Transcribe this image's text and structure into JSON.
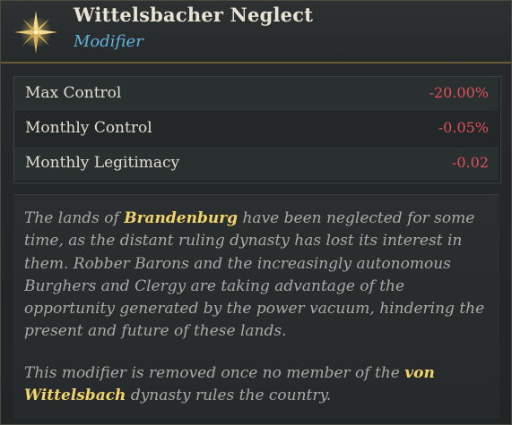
{
  "header": {
    "title": "Wittelsbacher Neglect",
    "subtitle": "Modifier",
    "icon": "compass-star-icon"
  },
  "modifiers": [
    {
      "label": "Max Control",
      "value": "-20.00%"
    },
    {
      "label": "Monthly Control",
      "value": "-0.05%"
    },
    {
      "label": "Monthly Legitimacy",
      "value": "-0.02"
    }
  ],
  "description": {
    "p1_pre": "The lands of ",
    "p1_hl": "Brandenburg",
    "p1_post": " have been neglected for some time, as the distant ruling dynasty has lost its interest in them. Robber Barons and the increasingly autonomous Burghers and Clergy are taking advantage of the opportunity generated by the power vacuum, hindering the present and future of these lands.",
    "p2_pre": "This modifier is removed once no member of the ",
    "p2_hl": "von Wittelsbach",
    "p2_post": " dynasty rules the country."
  },
  "colors": {
    "negative": "#e0505a",
    "highlight": "#f3d36b",
    "subtitle": "#5fb2dc"
  }
}
